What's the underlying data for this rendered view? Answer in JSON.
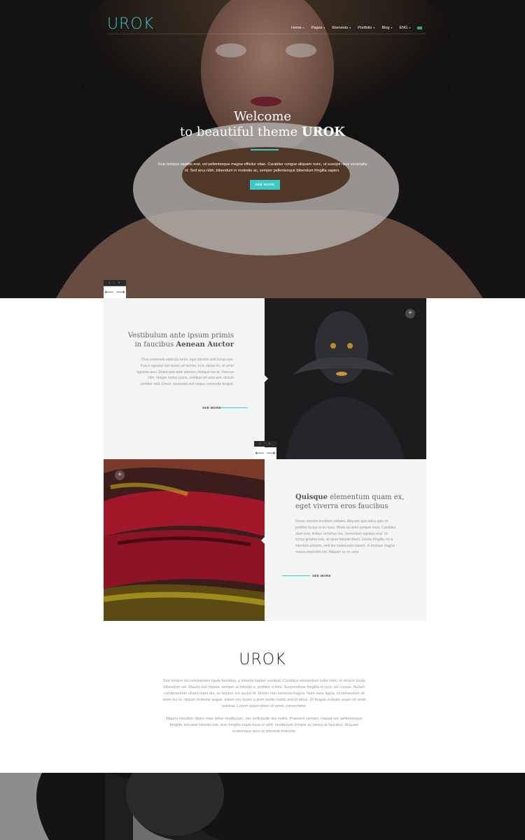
{
  "header": {
    "logo": "UROK",
    "nav": [
      {
        "label": "Home",
        "chevron": "▾"
      },
      {
        "label": "Pages",
        "chevron": "▾"
      },
      {
        "label": "Elements",
        "chevron": "▾"
      },
      {
        "label": "Portfolio",
        "chevron": "▾"
      },
      {
        "label": "Blog",
        "chevron": "▾"
      },
      {
        "label": "ENG",
        "chevron": "▾"
      }
    ]
  },
  "hero": {
    "title_line1": "Welcome",
    "title_line2_prefix": "to beautiful theme ",
    "title_line2_bold": "UROK",
    "text": "Duis tempus sagittis erat, vel pellentesque magna efficitur vitae. Curabitur congue aliquam nunc, ut suscipit risus venenatis id. Sed arcu nibh, bibendum in molestie ac, semper pellentesque bibendum fringilla sapien.",
    "button": "SEE MORE",
    "pager": "1 / 3"
  },
  "feature1": {
    "title_line1": "Vestibulum ante ipsum primis",
    "title_line2_prefix": "in faucibus ",
    "title_line2_bold": "Aenean Auctor",
    "text": "Duis commodo vehicula tortor, eget lobortis velit luctus non. Fusce egestas non turpis vel lacinia. In in varius mi, sit amet egestas arcu. Etiam quis ante ultricies, tristique est at, rhoncus nibh. Integer metus purus, volutpat vel urna sed, dictum porttitor velit. Donec venenatis sed neque commodo feugiat.",
    "link": "SEE MORE",
    "pager": "1 / 3"
  },
  "feature2": {
    "title_line1_bold": "Quisque",
    "title_line1_rest": " elementum quam ex,",
    "title_line2": "eget viverra eros faucibus",
    "text": "Donec pretium tincidunt sodales. Aliquam quis tellus quis mi porttitor luctus ut eu nunc. Morbi sit amet semper risus. Curabitur diam erat, finibus vel tellus nec, fermentum egestas erat. Ut luctus gravida erat, sit amet lobortis libero. Donec fringilla, ex a interdum pretium, velit leo malesuada mauris, et tristique magna massa imperdiet leo. Aliquam ac ex urna.",
    "link": "SEE MORE"
  },
  "about": {
    "logo": "UROK",
    "para1": "Sed tempor orci elementum ligula faucibus, a lobortis sapien volutpat. Curabitur elementum nulla nunc, in dictum turpis bibendum vel. Mauris nisl massa, semper ut lobortis a, porttitor a felis. Suspendisse fringilla id nunc vel cursus. Nullam condimentum ullamcorper dui, ac tempor est auctor id. Donec non vehicula magna. Nam nunc ligula, condimentum sit amet leo ut, aliquet molestie augue. Etiam nec turpis a ante mollis mattis sed id tellus. Ut feugiat sodales quam sit amet pulvinar. Lorem ipsum dolor sit amet, consectetur.",
    "para2": "Mauris interdum libero vitae tellus vestibulum, nec sollicitudin dui mollis. Praesent semper, massa nec pellentesque fringilla, est ante lobortis nisi, quis fringilla turpis risus ut velit. Vestibulum tempor ac metus at faucibus. Aliquam scelerisque arcu ac placerat molestie."
  },
  "colors": {
    "accent": "#3cc7c9",
    "panel": "#f3f4f4",
    "dark": "#1b1a1d"
  },
  "icons": {
    "plus": "+",
    "arrow_left": "⟵",
    "arrow_right": "⟶"
  }
}
